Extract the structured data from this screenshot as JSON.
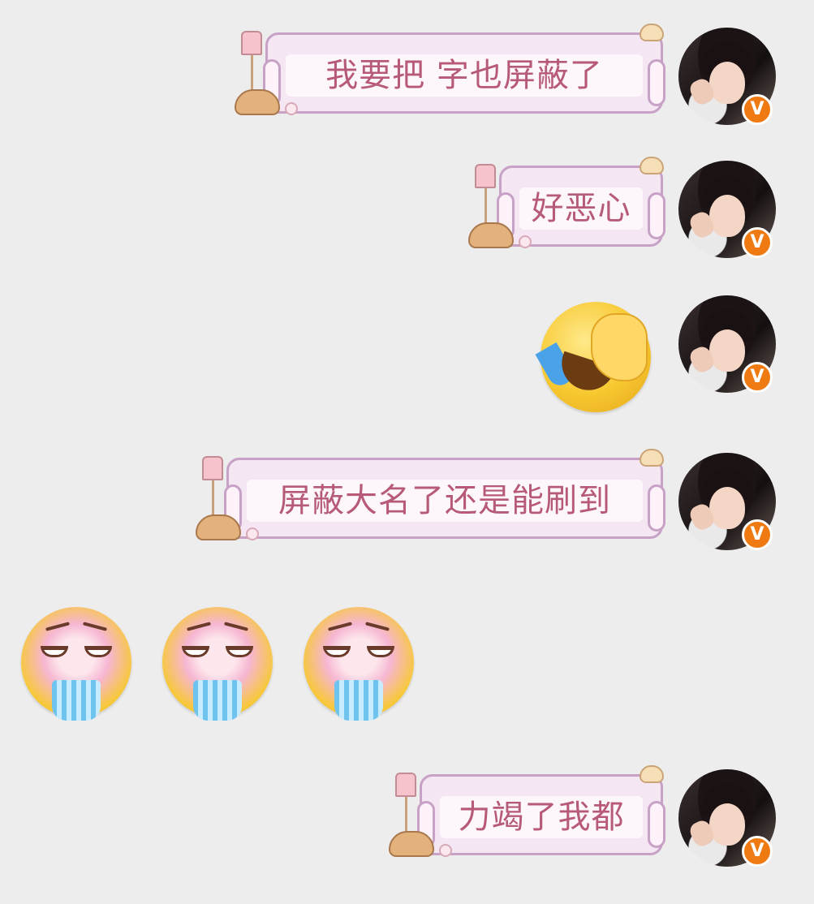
{
  "messages": [
    {
      "type": "text",
      "text": "我要把    字也屏蔽了",
      "sender": "self",
      "verified_badge": "V"
    },
    {
      "type": "text",
      "text": "好恶心",
      "sender": "self",
      "verified_badge": "V"
    },
    {
      "type": "emoji",
      "emoji": "face-palm-laugh-crying",
      "sender": "self",
      "verified_badge": "V"
    },
    {
      "type": "text",
      "text": "屏蔽大名了还是能刷到",
      "sender": "self",
      "verified_badge": "V"
    },
    {
      "type": "emoji-group",
      "emoji": "vomiting-face",
      "count": 3,
      "sender": "other"
    },
    {
      "type": "text",
      "text": "力竭了我都",
      "sender": "self",
      "verified_badge": "V"
    }
  ],
  "colors": {
    "background": "#ededed",
    "bubble_text": "#b75a78",
    "bubble_border": "#c7a2c6",
    "badge": "#f07a12"
  }
}
